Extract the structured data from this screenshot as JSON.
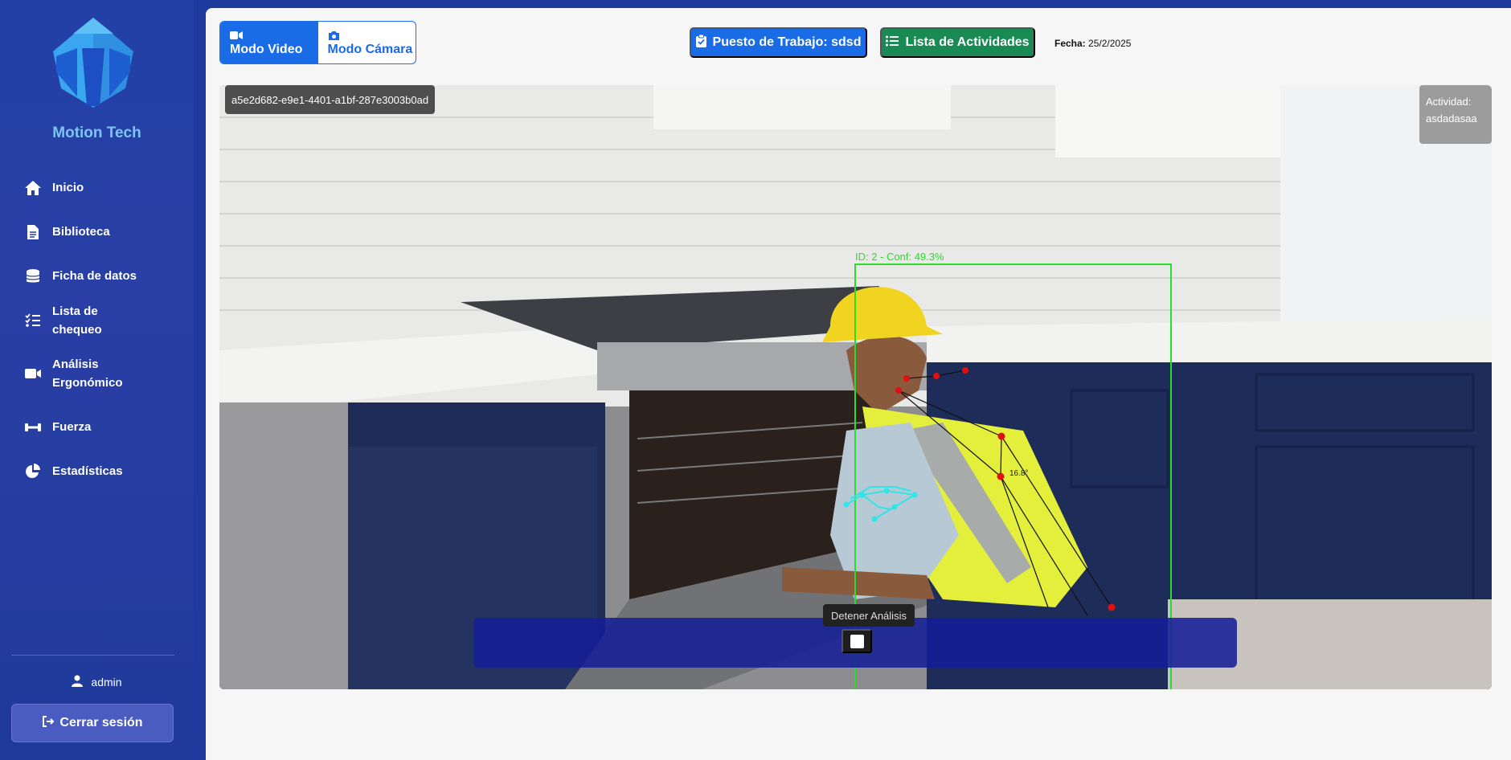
{
  "sidebar": {
    "brand": "Motion Tech",
    "items": [
      {
        "label": "Inicio",
        "icon": "home-icon"
      },
      {
        "label": "Biblioteca",
        "icon": "file-icon"
      },
      {
        "label": "Ficha de datos",
        "icon": "database-icon"
      },
      {
        "label": "Lista de chequeo",
        "icon": "checklist-icon"
      },
      {
        "label": "Análisis Ergonómico",
        "icon": "video-camera-icon"
      },
      {
        "label": "Fuerza",
        "icon": "dumbbell-icon"
      },
      {
        "label": "Estadísticas",
        "icon": "pie-chart-icon"
      }
    ],
    "user": "admin",
    "logout_label": "Cerrar sesión"
  },
  "header": {
    "mode_video": "Modo Video",
    "mode_camera": "Modo Cámara",
    "work_station_label": "Puesto de Trabajo: sdsd",
    "activities_label": "Lista de Actividades",
    "date_label": "Fecha:",
    "date_value": "25/2/2025"
  },
  "video": {
    "session_id": "a5e2d682-e9e1-4401-a1bf-287e3003b0ad",
    "activity_label": "Actividad:",
    "activity_value": "asdadasaa",
    "detection_label": "ID: 2 - Conf: 49.3%",
    "angle_label": "16.8°",
    "stop_tooltip": "Detener Análisis"
  },
  "colors": {
    "primary": "#1a6be6",
    "success": "#1a8a55",
    "sidebar": "#2240a6",
    "detection": "#2bdc2b",
    "keypoint": "#e01010"
  }
}
